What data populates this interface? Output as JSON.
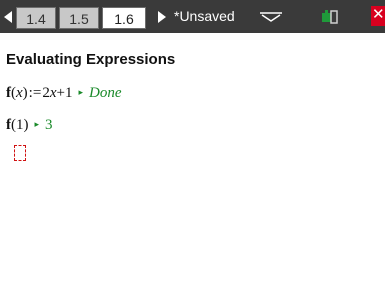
{
  "toolbar": {
    "tabs": [
      {
        "label": "1.4",
        "active": false
      },
      {
        "label": "1.5",
        "active": false
      },
      {
        "label": "1.6",
        "active": true
      }
    ],
    "document_title": "*Unsaved",
    "close_symbol": "✕"
  },
  "main": {
    "heading": "Evaluating Expressions",
    "lines": [
      {
        "fn": "f",
        "open_paren": "(",
        "var": "x",
        "close_paren": ")",
        "assign": ":=",
        "expr": "2",
        "expr_var": "x",
        "expr_rest": "+1",
        "arrow": "▸",
        "result": "Done"
      },
      {
        "fn": "f",
        "open_paren": "(",
        "arg": "1",
        "close_paren": ")",
        "arrow": "▸",
        "result": "3"
      }
    ]
  },
  "colors": {
    "topbar": "#3a3a3a",
    "result_green": "#1a8a2a",
    "cursor_red": "#d01010",
    "close_red": "#d8001f"
  },
  "icons": {
    "nav_left": "triangle-left-icon",
    "nav_right": "triangle-right-icon",
    "dropdown": "chevron-down-icon",
    "status": "battery-status-icon",
    "close": "close-icon"
  }
}
